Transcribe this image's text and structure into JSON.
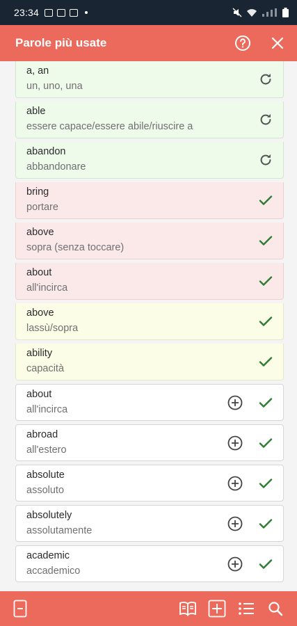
{
  "status_bar": {
    "time": "23:34"
  },
  "app_bar": {
    "title": "Parole più usate",
    "help_icon": "help-circle-icon",
    "close_icon": "close-icon"
  },
  "colors": {
    "accent": "#ec6a5c",
    "status_bar": "#1a2533",
    "review_green": "#eefaea",
    "review_red": "#fbe9ea",
    "review_yellow": "#fcfde6",
    "check": "#2e7d32"
  },
  "words": [
    {
      "word": "a, an",
      "translation": "un, uno, una",
      "state": "green",
      "action": "refresh-icon",
      "add": false
    },
    {
      "word": "able",
      "translation": "essere capace/essere abile/riuscire a",
      "state": "green",
      "action": "refresh-icon",
      "add": false
    },
    {
      "word": "abandon",
      "translation": "abbandonare",
      "state": "green",
      "action": "refresh-icon",
      "add": false
    },
    {
      "word": "bring",
      "translation": "portare",
      "state": "red",
      "action": "check-icon",
      "add": false
    },
    {
      "word": "above",
      "translation": "sopra (senza toccare)",
      "state": "red",
      "action": "check-icon",
      "add": false
    },
    {
      "word": "about",
      "translation": "all'incirca",
      "state": "red",
      "action": "check-icon",
      "add": false
    },
    {
      "word": "above",
      "translation": "lassù/sopra",
      "state": "yellow",
      "action": "check-icon",
      "add": false
    },
    {
      "word": "ability",
      "translation": "capacità",
      "state": "yellow",
      "action": "check-icon",
      "add": false
    },
    {
      "word": "about",
      "translation": "all'incirca",
      "state": "white",
      "action": "check-icon",
      "add": true
    },
    {
      "word": "abroad",
      "translation": "all'estero",
      "state": "white",
      "action": "check-icon",
      "add": true
    },
    {
      "word": "absolute",
      "translation": "assoluto",
      "state": "white",
      "action": "check-icon",
      "add": true
    },
    {
      "word": "absolutely",
      "translation": "assolutamente",
      "state": "white",
      "action": "check-icon",
      "add": true
    },
    {
      "word": "academic",
      "translation": "accademico",
      "state": "white",
      "action": "check-icon",
      "add": true
    }
  ],
  "bottom_bar": {
    "items": [
      "minus-icon",
      "book-icon",
      "add-box-icon",
      "list-icon",
      "search-icon"
    ]
  }
}
